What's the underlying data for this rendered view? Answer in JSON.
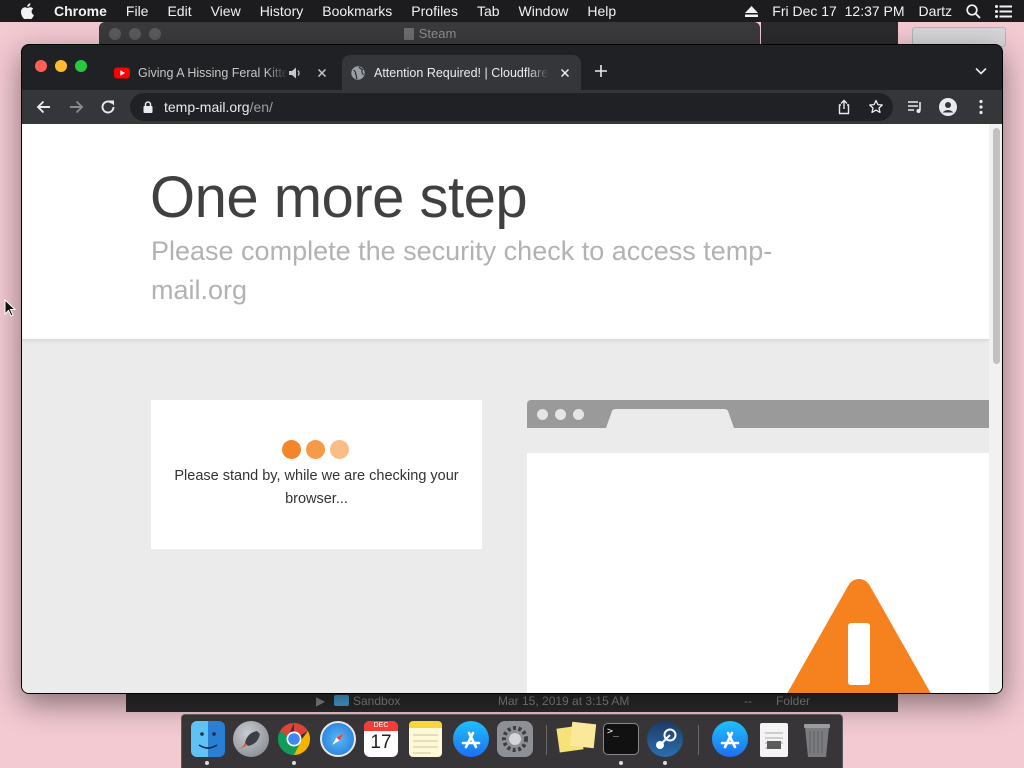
{
  "menubar": {
    "app_name": "Chrome",
    "items": [
      "File",
      "Edit",
      "View",
      "History",
      "Bookmarks",
      "Profiles",
      "Tab",
      "Window",
      "Help"
    ],
    "datetime": "Fri Dec 17  12:37 PM",
    "user": "Dartz"
  },
  "background": {
    "steam_title": "Steam",
    "finder_row": {
      "name": "Sandbox",
      "date": "Mar 15, 2019 at 3:15 AM",
      "size": "--",
      "kind": "Folder"
    }
  },
  "browser": {
    "tabs": [
      {
        "title": "Giving A Hissing Feral Kitten",
        "favicon": "youtube-icon",
        "audio": true,
        "active": false
      },
      {
        "title": "Attention Required! | Cloudflare",
        "favicon": "globe-icon",
        "audio": false,
        "active": true
      }
    ],
    "url": {
      "host": "temp-mail.org",
      "path": "/en/"
    }
  },
  "page": {
    "title": "One more step",
    "subtitle": "Please complete the security check to access temp-mail.org",
    "check_message": "Please stand by, while we are checking your browser...",
    "loader_colors": [
      "#f4852b",
      "#f69a47",
      "#f9bd88"
    ],
    "accent_color": "#f6821f"
  },
  "dock": {
    "apps": [
      "Finder",
      "Launchpad",
      "Google Chrome",
      "Safari",
      "Calendar",
      "Notes",
      "App Store",
      "System Preferences",
      "Stickies",
      "Terminal",
      "Steam",
      "App Store",
      "Preview",
      "Trash"
    ],
    "calendar_month": "DEC",
    "calendar_day": "17"
  }
}
